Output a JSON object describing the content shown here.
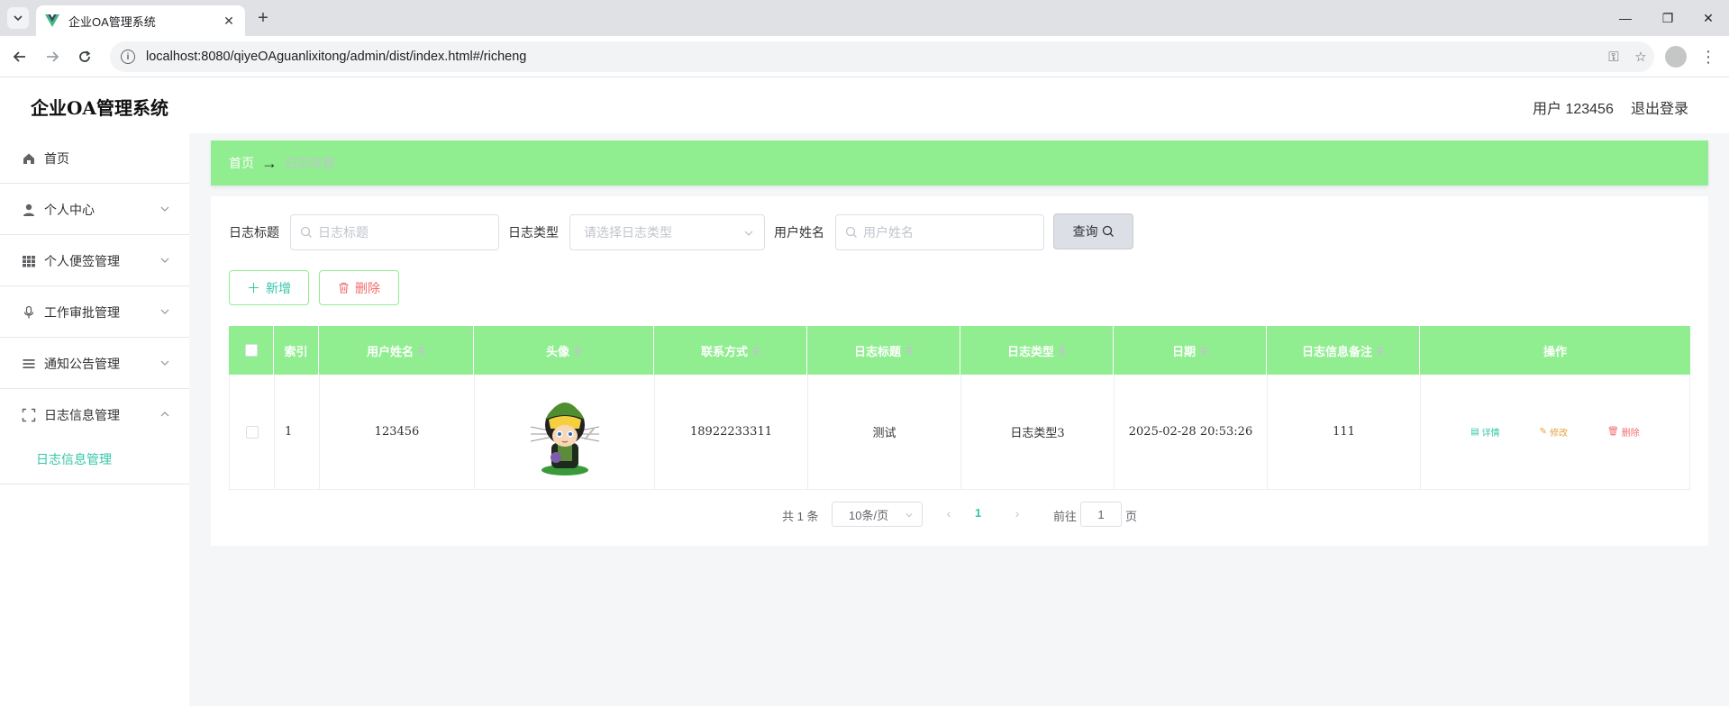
{
  "browser": {
    "tab_title": "企业OA管理系统",
    "url": "localhost:8080/qiyeOAguanlixitong/admin/dist/index.html#/richeng"
  },
  "header": {
    "app_title": "企业OA管理系统",
    "user_label": "用户 123456",
    "logout_label": "退出登录"
  },
  "sidebar": {
    "items": [
      {
        "label": "首页",
        "icon": "home-icon"
      },
      {
        "label": "个人中心",
        "icon": "user-icon"
      },
      {
        "label": "个人便签管理",
        "icon": "grid-icon"
      },
      {
        "label": "工作审批管理",
        "icon": "microphone-icon"
      },
      {
        "label": "通知公告管理",
        "icon": "list-icon"
      },
      {
        "label": "日志信息管理",
        "icon": "fullscreen-icon"
      }
    ],
    "active_sub": "日志信息管理"
  },
  "breadcrumb": {
    "home": "首页",
    "separator": "→",
    "current": "日志信息"
  },
  "filters": {
    "title_label": "日志标题",
    "title_placeholder": "日志标题",
    "type_label": "日志类型",
    "type_placeholder": "请选择日志类型",
    "user_label": "用户姓名",
    "user_placeholder": "用户姓名",
    "query_button": "查询"
  },
  "actions": {
    "add": "新增",
    "delete": "删除"
  },
  "table": {
    "columns": [
      "索引",
      "用户姓名",
      "头像",
      "联系方式",
      "日志标题",
      "日志类型",
      "日期",
      "日志信息备注",
      "操作"
    ],
    "rows": [
      {
        "index": "1",
        "username": "123456",
        "avatar": "cartoon-avatar",
        "phone": "18922233311",
        "log_title": "测试",
        "log_type": "日志类型3",
        "date": "2025-02-28 20:53:26",
        "remark": "111"
      }
    ],
    "row_actions": {
      "detail": "详情",
      "edit": "修改",
      "delete": "删除"
    }
  },
  "pagination": {
    "total": "共 1 条",
    "page_size": "10条/页",
    "current_page": "1",
    "goto_label": "前往",
    "goto_value": "1",
    "page_suffix": "页"
  },
  "colors": {
    "accent_green": "#90ee90",
    "teal": "#36c6a8",
    "danger": "#f56c6c",
    "warning": "#e6a23c"
  }
}
